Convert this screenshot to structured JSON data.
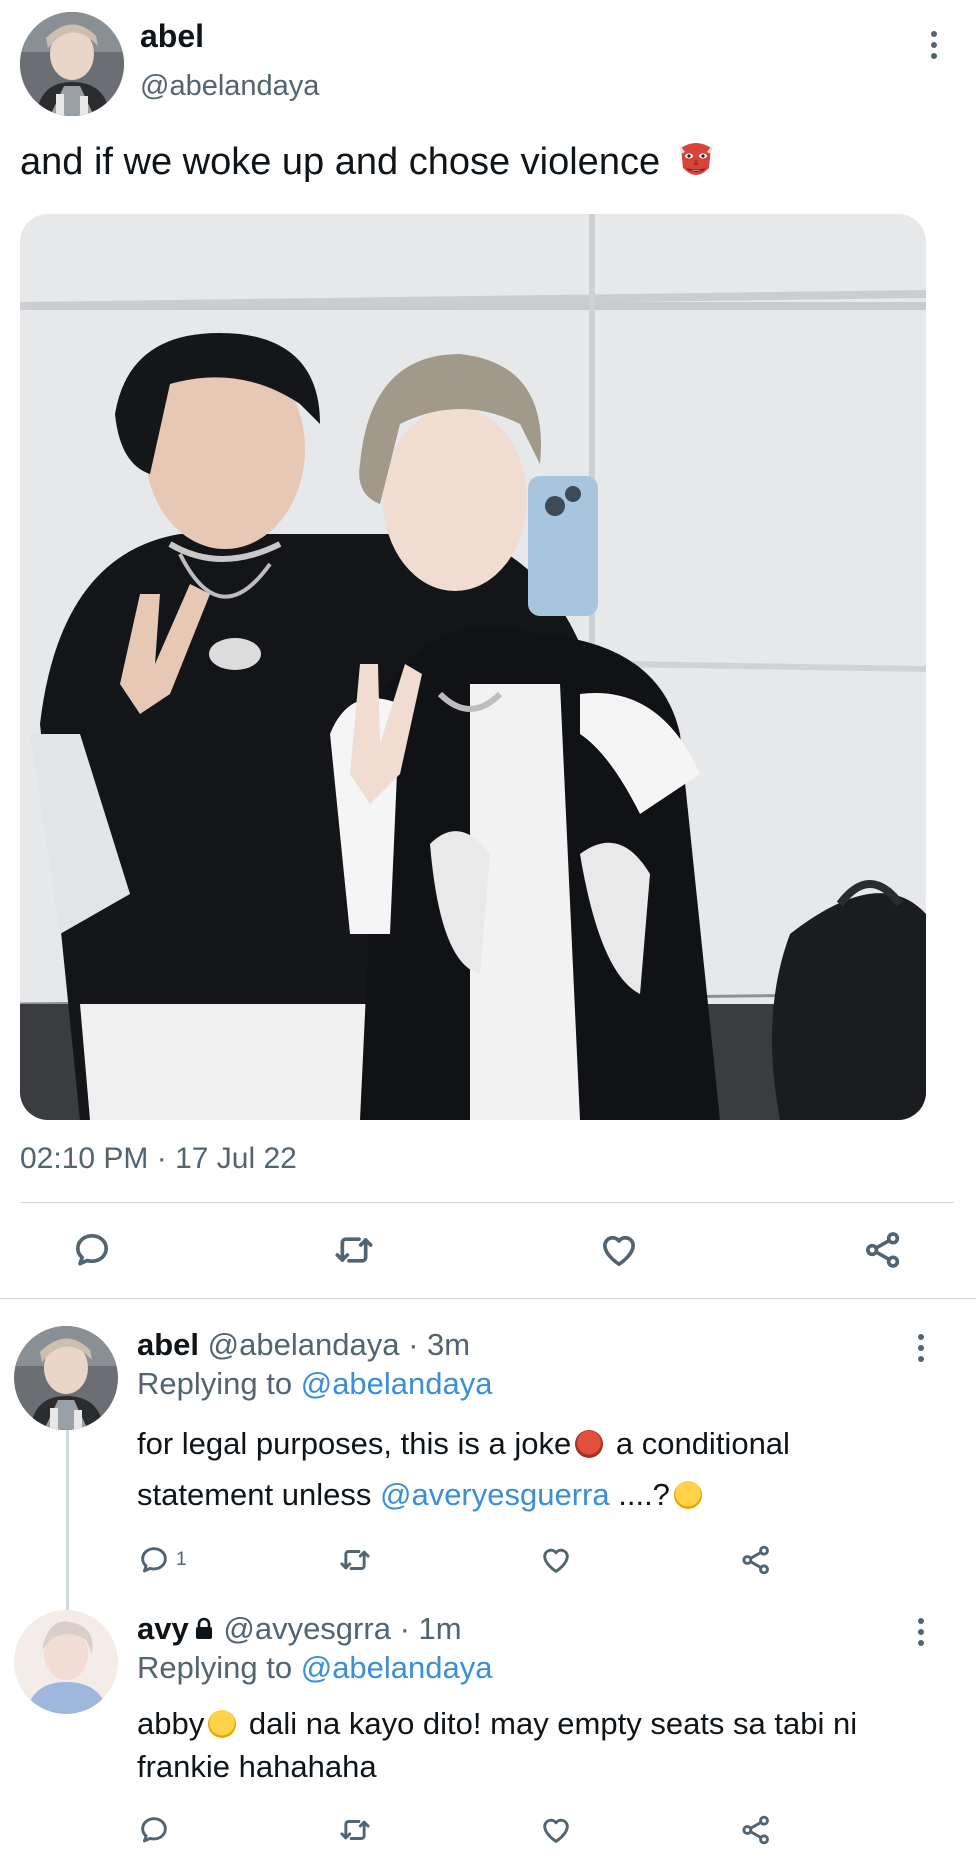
{
  "tweet": {
    "author_name": "abel",
    "author_handle": "@abelandaya",
    "text": "and if we woke up and chose violence",
    "emoji": "goblin-mask-emoji",
    "timestamp": "02:10 PM · 17 Jul 22"
  },
  "replies": [
    {
      "name": "abel",
      "handle": "@abelandaya",
      "age": "3m",
      "replying_label": "Replying to",
      "replying_to": "@abelandaya",
      "body_part1": "for legal purposes, this is a joke",
      "body_part2": "a conditional statement unless",
      "mention": "@averyesguerra",
      "body_part3": "....?",
      "reply_count": "1",
      "locked": false
    },
    {
      "name": "avy",
      "handle": "@avyesgrra",
      "age": "1m",
      "replying_label": "Replying to",
      "replying_to": "@abelandaya",
      "body_part1": "abby",
      "body_part2": "dali na kayo dito! may empty seats sa tabi ni frankie hahahaha",
      "reply_count": "",
      "locked": true
    }
  ],
  "icons": {
    "reply": "speech-bubble-icon",
    "retweet": "retweet-icon",
    "like": "heart-icon",
    "share": "share-icon",
    "more": "vertical-dots-icon",
    "lock": "lock-icon"
  },
  "colors": {
    "text": "#0f1419",
    "muted": "#536471",
    "link": "#3a8fd6",
    "divider": "#d4d9dd"
  }
}
